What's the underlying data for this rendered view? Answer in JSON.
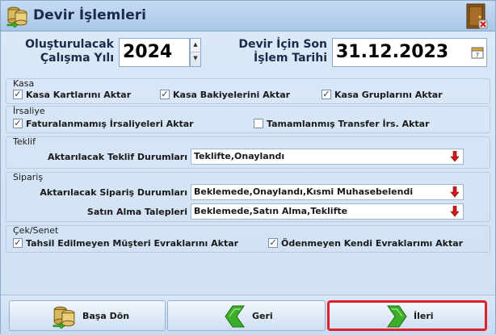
{
  "window": {
    "title": "Devir İşlemleri",
    "title_icon": "database-transfer-icon",
    "exit_icon": "exit-door-icon"
  },
  "header": {
    "year_label_line1": "Oluşturulacak",
    "year_label_line2": "Çalışma Yılı",
    "year_value": "2024",
    "date_label_line1": "Devir İçin Son",
    "date_label_line2": "İşlem Tarihi",
    "date_value": "31.12.2023",
    "calendar_day": "7"
  },
  "kasa": {
    "title": "Kasa",
    "items": [
      {
        "label": "Kasa Kartlarını Aktar",
        "checked": true
      },
      {
        "label": "Kasa Bakiyelerini Aktar",
        "checked": true
      },
      {
        "label": "Kasa Gruplarını Aktar",
        "checked": true
      }
    ]
  },
  "irsaliye": {
    "title": "İrsaliye",
    "items": [
      {
        "label": "Faturalanmamış İrsaliyeleri Aktar",
        "checked": true
      },
      {
        "label": "Tamamlanmış Transfer İrs. Aktar",
        "checked": false
      }
    ]
  },
  "teklif": {
    "title": "Teklif",
    "status_label": "Aktarılacak Teklif Durumları",
    "status_value": "Teklifte,Onaylandı"
  },
  "siparis": {
    "title": "Sipariş",
    "status_label": "Aktarılacak Sipariş Durumları",
    "status_value": "Beklemede,Onaylandı,Kısmi Muhasebelendi",
    "purchase_label": "Satın Alma Talepleri",
    "purchase_value": "Beklemede,Satın Alma,Teklifte"
  },
  "cek_senet": {
    "title": "Çek/Senet",
    "items": [
      {
        "label": "Tahsil Edilmeyen Müşteri Evraklarını Aktar",
        "checked": true
      },
      {
        "label": "Ödenmeyen Kendi Evraklarımı Aktar",
        "checked": true
      }
    ]
  },
  "buttons": {
    "home": "Başa Dön",
    "back": "Geri",
    "next": "İleri"
  },
  "colors": {
    "accent_border": "#e0202a",
    "arrow_green": "#3cae2a",
    "combo_arrow": "#d01a1a"
  }
}
